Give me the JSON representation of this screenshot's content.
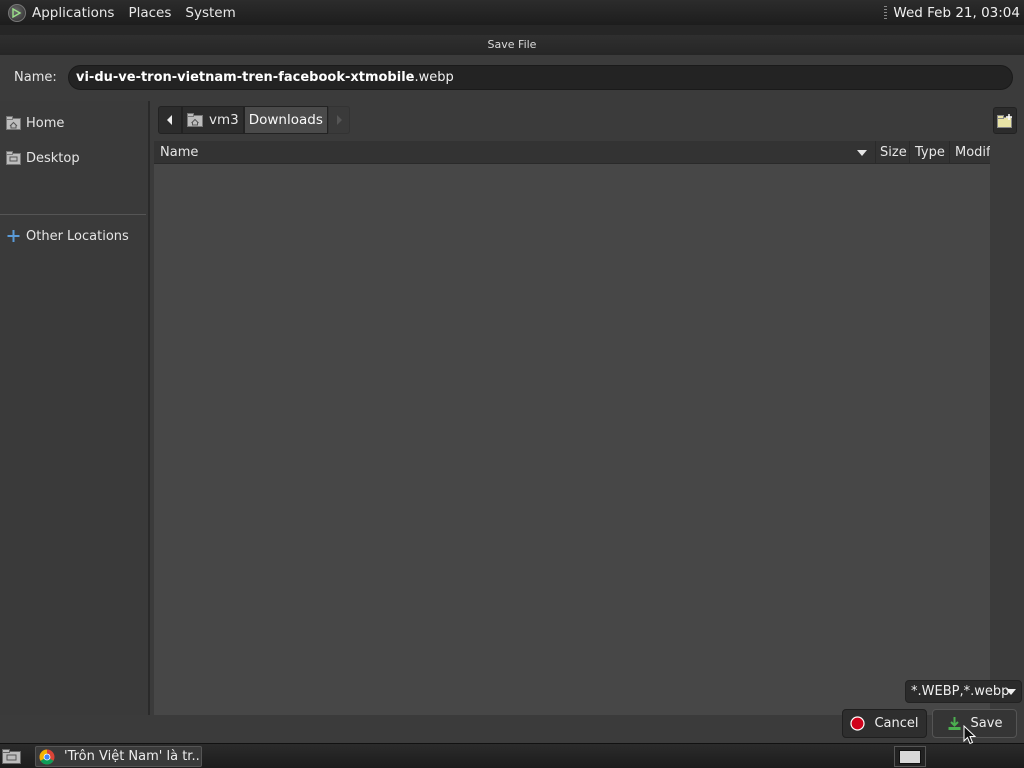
{
  "top_panel": {
    "menus": [
      "Applications",
      "Places",
      "System"
    ],
    "clock": "Wed Feb 21, 03:04"
  },
  "dialog": {
    "title": "Save File",
    "name_label": "Name:",
    "filename_base": "vi-du-ve-tron-vietnam-tren-facebook-xtmobile",
    "filename_ext": ".webp"
  },
  "sidebar": {
    "items": [
      {
        "label": "Home",
        "icon": "home-folder-icon"
      },
      {
        "label": "Desktop",
        "icon": "desktop-folder-icon"
      },
      {
        "label": "Other Locations",
        "icon": "plus-icon"
      }
    ]
  },
  "pathbar": {
    "segments": [
      "vm3",
      "Downloads"
    ],
    "active": "Downloads"
  },
  "file_list": {
    "columns": [
      "Name",
      "Size",
      "Type",
      "Modif"
    ],
    "rows": []
  },
  "filter": {
    "selected": "*.WEBP,*.webp"
  },
  "buttons": {
    "cancel": "Cancel",
    "save": "Save"
  },
  "taskbar": {
    "task_label": "'Trôn Việt Nam' là tr..."
  },
  "colors": {
    "accent_cancel": "#d0021b",
    "accent_save": "#4caf50",
    "background": "#3b3b3b"
  }
}
